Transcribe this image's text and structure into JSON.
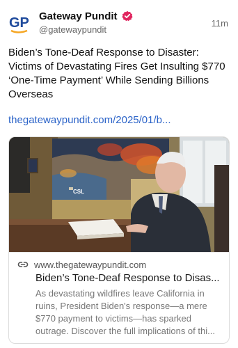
{
  "account": {
    "name": "Gateway Pundit",
    "handle": "@gatewaypundit",
    "time": "11m",
    "avatar_text": "GP",
    "verified_color": "#e0245e",
    "brand_color": "#1e4a9c",
    "accent_color": "#f5a623"
  },
  "post": {
    "text": "Biden’s Tone-Deaf Response to Disaster: Victims of Devastating Fires Get Insulting $770 ‘One-Time Payment’ While Sending Billions Overseas",
    "link_text": "thegatewaypundit.com/2025/01/b..."
  },
  "card": {
    "domain": "www.thegatewaypundit.com",
    "title": "Biden’s Tone-Deaf Response to Disas...",
    "description": "As devastating wildfires leave California in ruins, President Biden's response—a mere $770 payment to victims—has sparked outrage. Discover the full implications of thi...",
    "image_watermark": "CSL",
    "link_icon": "link-icon"
  }
}
